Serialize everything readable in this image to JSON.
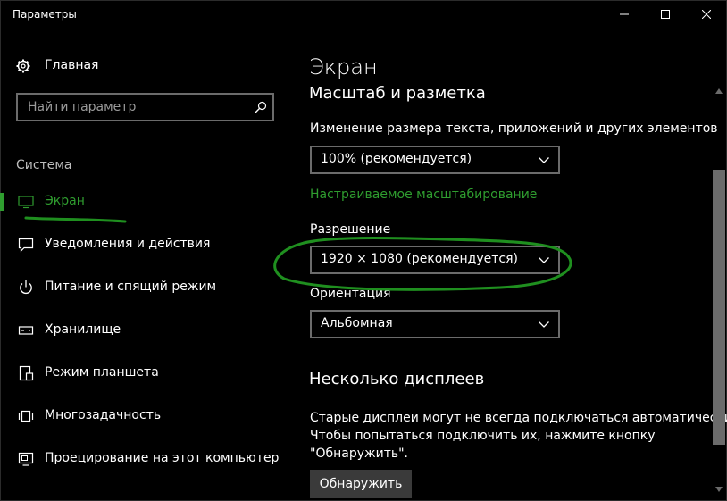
{
  "window": {
    "title": "Параметры"
  },
  "sidebar": {
    "home_label": "Главная",
    "search_placeholder": "Найти параметр",
    "section_label": "Система",
    "items": [
      {
        "label": "Экран",
        "icon": "monitor-icon",
        "active": true
      },
      {
        "label": "Уведомления и действия",
        "icon": "notification-icon",
        "active": false
      },
      {
        "label": "Питание и спящий режим",
        "icon": "power-icon",
        "active": false
      },
      {
        "label": "Хранилище",
        "icon": "storage-icon",
        "active": false
      },
      {
        "label": "Режим планшета",
        "icon": "tablet-mode-icon",
        "active": false
      },
      {
        "label": "Многозадачность",
        "icon": "multitasking-icon",
        "active": false
      },
      {
        "label": "Проецирование на этот компьютер",
        "icon": "projection-icon",
        "active": false
      }
    ]
  },
  "content": {
    "page_title": "Экран",
    "scale_section_title": "Масштаб и разметка",
    "scale_label": "Изменение размера текста, приложений и других элементов",
    "scale_value": "100% (рекомендуется)",
    "custom_scaling_link": "Настраиваемое масштабирование",
    "resolution_label": "Разрешение",
    "resolution_value": "1920 × 1080 (рекомендуется)",
    "orientation_label": "Ориентация",
    "orientation_value": "Альбомная",
    "multi_display_title": "Несколько дисплеев",
    "multi_display_desc": [
      "Старые дисплеи могут не всегда подключаться автоматически.",
      "Чтобы попытаться подключить их, нажмите кнопку",
      "\"Обнаружить\"."
    ],
    "detect_button": "Обнаружить"
  },
  "colors": {
    "background": "#000000",
    "accent": "#2f9d2f",
    "annotation": "#1f8f1f",
    "border": "#6b6b6b"
  }
}
